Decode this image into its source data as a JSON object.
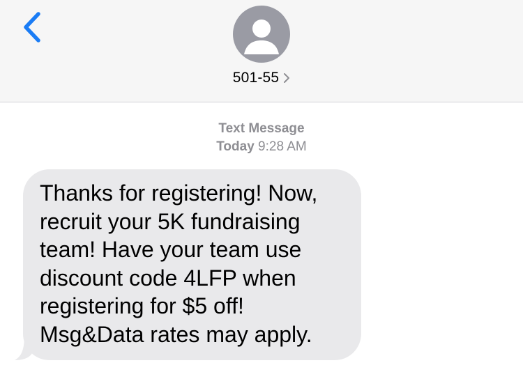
{
  "header": {
    "back_icon": "chevron-left-icon",
    "avatar_icon": "person-icon",
    "contact_name": "501-55",
    "contact_chevron_icon": "chevron-right-icon",
    "accent_color": "#1a7cf5"
  },
  "thread": {
    "message_type": "Text Message",
    "day": "Today",
    "time": "9:28 AM",
    "messages": [
      {
        "direction": "incoming",
        "text": "Thanks for registering! Now,\nrecruit your 5K fundraising\nteam! Have your team use\ndiscount code 4LFP when\nregistering for $5 off!\nMsg&Data rates may apply."
      }
    ]
  }
}
